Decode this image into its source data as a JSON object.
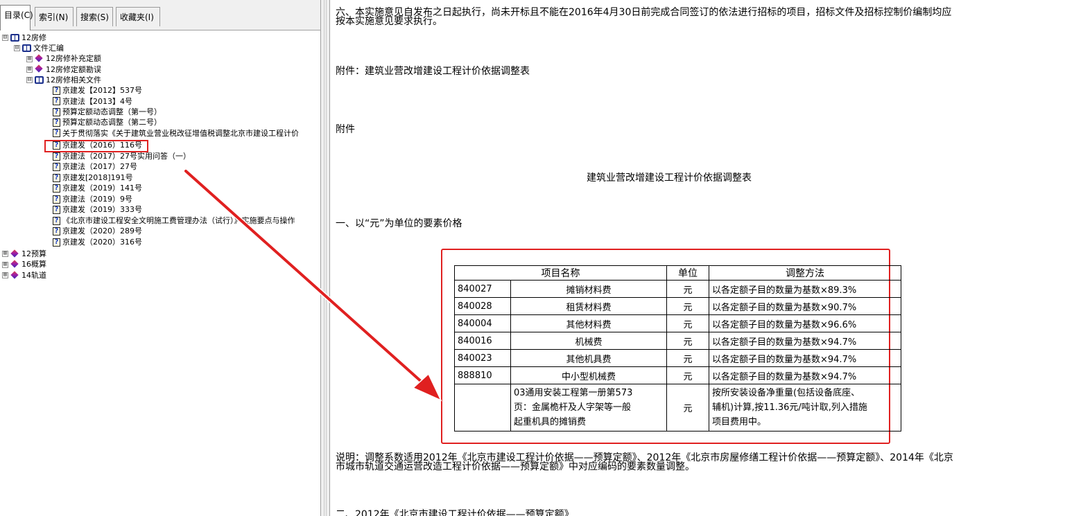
{
  "tabs": [
    {
      "label": "目录(C)",
      "active": true
    },
    {
      "label": "索引(N)",
      "active": false
    },
    {
      "label": "搜索(S)",
      "active": false
    },
    {
      "label": "收藏夹(I)",
      "active": false
    }
  ],
  "tree": [
    {
      "label": "12房修",
      "level": 0,
      "expander": "⊟",
      "icon": "book-open-icon"
    },
    {
      "label": "文件汇编",
      "level": 1,
      "expander": "⊟",
      "icon": "book-open-icon"
    },
    {
      "label": "12房修补充定额",
      "level": 2,
      "expander": "⊞",
      "icon": "book-closed-icon"
    },
    {
      "label": "12房修定额勘误",
      "level": 2,
      "expander": "⊞",
      "icon": "book-closed-icon"
    },
    {
      "label": "12房修相关文件",
      "level": 2,
      "expander": "⊟",
      "icon": "book-open-icon"
    },
    {
      "label": "京建发【2012】537号",
      "level": 3,
      "icon": "help-page-icon"
    },
    {
      "label": "京建法【2013】4号",
      "level": 3,
      "icon": "help-page-icon"
    },
    {
      "label": "预算定额动态调整（第一号）",
      "level": 3,
      "icon": "help-page-icon"
    },
    {
      "label": "预算定额动态调整（第二号）",
      "level": 3,
      "icon": "help-page-icon"
    },
    {
      "label": "关于贯彻落实《关于建筑业营业税改征增值税调整北京市建设工程计价",
      "level": 3,
      "icon": "help-page-icon"
    },
    {
      "label": "京建发（2016）116号",
      "level": 3,
      "icon": "help-page-icon",
      "selected": true
    },
    {
      "label": "京建法（2017）27号实用问答（一）",
      "level": 3,
      "icon": "help-page-icon"
    },
    {
      "label": "京建法（2017）27号",
      "level": 3,
      "icon": "help-page-icon"
    },
    {
      "label": "京建发[2018]191号",
      "level": 3,
      "icon": "help-page-icon"
    },
    {
      "label": "京建发（2019）141号",
      "level": 3,
      "icon": "help-page-icon"
    },
    {
      "label": "京建法（2019）9号",
      "level": 3,
      "icon": "help-page-icon"
    },
    {
      "label": "京建发（2019）333号",
      "level": 3,
      "icon": "help-page-icon"
    },
    {
      "label": "《北京市建设工程安全文明施工费管理办法（试行）》实施要点与操作",
      "level": 3,
      "icon": "help-page-icon"
    },
    {
      "label": "京建发（2020）289号",
      "level": 3,
      "icon": "help-page-icon"
    },
    {
      "label": "京建发（2020）316号",
      "level": 3,
      "icon": "help-page-icon"
    },
    {
      "label": "12预算",
      "level": 0,
      "expander": "⊞",
      "icon": "book-closed-icon"
    },
    {
      "label": "16概算",
      "level": 0,
      "expander": "⊞",
      "icon": "book-closed-icon"
    },
    {
      "label": "14轨道",
      "level": 0,
      "expander": "⊞",
      "icon": "book-closed-icon"
    }
  ],
  "doc": {
    "p6_line1": "六、本实施意见自发布之日起执行，尚未开标且不能在2016年4月30日前完成合同签订的依法进行招标的项目，招标文件及招标控制价编制均应",
    "p6_line2": "按本实施意见要求执行。",
    "attachment_ref": "附件：建筑业营改增建设工程计价依据调整表",
    "attachment": "附件",
    "table_title": "建筑业营改增建设工程计价依据调整表",
    "section1": "一、以“元”为单位的要素价格",
    "table": {
      "headers": [
        "项目名称",
        "单位",
        "调整方法"
      ],
      "rows": [
        {
          "code": "840027",
          "name": "摊销材料费",
          "unit": "元",
          "method": "以各定额子目的数量为基数×89.3%"
        },
        {
          "code": "840028",
          "name": "租赁材料费",
          "unit": "元",
          "method": "以各定额子目的数量为基数×90.7%"
        },
        {
          "code": "840004",
          "name": "其他材料费",
          "unit": "元",
          "method": "以各定额子目的数量为基数×96.6%"
        },
        {
          "code": "840016",
          "name": "机械费",
          "unit": "元",
          "method": "以各定额子目的数量为基数×94.7%"
        },
        {
          "code": "840023",
          "name": "其他机具费",
          "unit": "元",
          "method": "以各定额子目的数量为基数×94.7%"
        },
        {
          "code": "888810",
          "name": "中小型机械费",
          "unit": "元",
          "method": "以各定额子目的数量为基数×94.7%"
        }
      ],
      "last_row": {
        "code": "",
        "name_lines": [
          "03通用安装工程第一册第573",
          "页：金属桅杆及人字架等一般",
          "起重机具的摊销费"
        ],
        "unit": "元",
        "method_lines": [
          "按所安装设备净重量(包括设备底座、",
          "辅机)计算,按11.36元/吨计取,列入措施",
          "项目费用中。"
        ]
      }
    },
    "note_line1": "说明：调整系数适用2012年《北京市建设工程计价依据——预算定额》、2012年《北京市房屋修缮工程计价依据——预算定额》、2014年《北京",
    "note_line2": "市城市轨道交通运营改造工程计价依据——预算定额》中对应编码的要素数量调整。",
    "section2_partial": "二、2012年《北京市建设工程计价依据——预算定额》"
  },
  "colors": {
    "highlight_red": "#e02020",
    "book_blue": "#1a2f8c",
    "help_icon_blue": "#1a3ec8"
  }
}
